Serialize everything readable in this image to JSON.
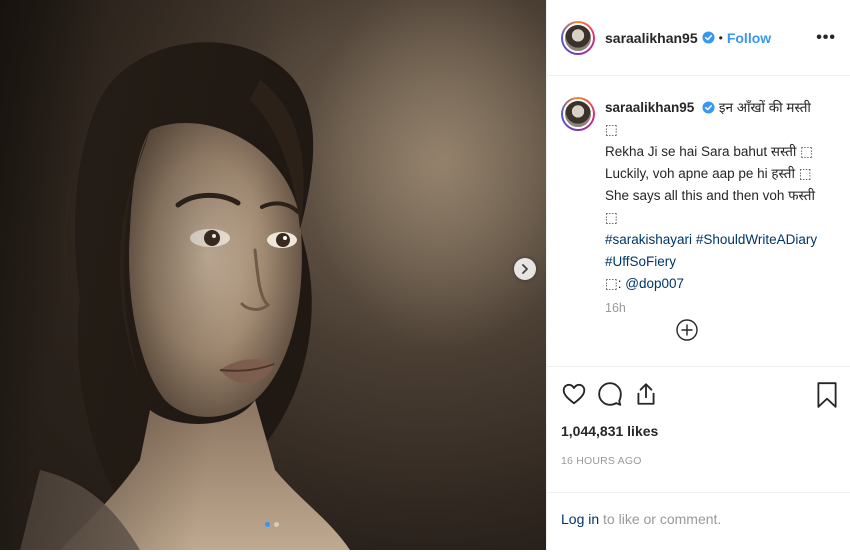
{
  "header": {
    "username": "saraalikhan95",
    "separator": "•",
    "follow_label": "Follow",
    "more_label": "•••"
  },
  "caption": {
    "username": "saraalikhan95",
    "lines": [
      "इन आँखों की मस्ती ⬚",
      "Rekha Ji se hai Sara bahut सस्ती ⬚",
      "Luckily, voh apne aap pe hi हस्ती ⬚",
      "She says all this and then voh फस्ती ⬚"
    ],
    "hashtags_line1": [
      "#sarakishayari",
      "#ShouldWriteADiary"
    ],
    "hashtags_line2": "#UffSoFiery",
    "credit_prefix": "⬚: ",
    "credit_mention": "@dop007",
    "time": "16h"
  },
  "engagement": {
    "likes": "1,044,831 likes",
    "posted_ago": "16 HOURS AGO"
  },
  "login_prompt": {
    "link": "Log in",
    "rest": " to like or comment."
  },
  "carousel": {
    "count": 2,
    "active_index": 0
  },
  "icons": {
    "like": "heart-icon",
    "comment": "comment-icon",
    "share": "share-icon",
    "save": "bookmark-icon",
    "next": "chevron-right-icon",
    "load_more": "plus-circle-icon",
    "verified": "verified-badge-icon"
  },
  "colors": {
    "accent_blue": "#3897f0",
    "link_dark_blue": "#003569",
    "muted_gray": "#999999",
    "text": "#262626"
  }
}
